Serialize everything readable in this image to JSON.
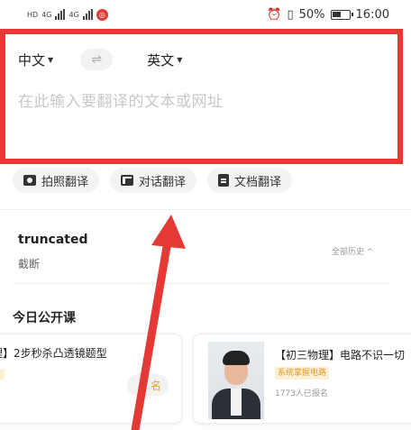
{
  "status_bar": {
    "sim_left": "HD",
    "net1": "4G",
    "net2": "4G",
    "battery": "50%",
    "time": "16:00"
  },
  "translator": {
    "source_lang": "中文",
    "target_lang": "英文",
    "placeholder": "在此输入要翻译的文本或网址"
  },
  "modes": [
    {
      "label": "拍照翻译",
      "icon": "camera-icon"
    },
    {
      "label": "对话翻译",
      "icon": "chat-icon"
    },
    {
      "label": "文档翻译",
      "icon": "document-icon"
    }
  ],
  "history": {
    "word": "truncated",
    "translation": "截断",
    "all_label": "全部历史 ^"
  },
  "courses": {
    "section_title": "今日公开课",
    "items": [
      {
        "title": "理】2步秒杀凸透镜题型",
        "button": "名"
      },
      {
        "title": "【初三物理】电路不识一切",
        "tag": "系统掌握电路",
        "enrolled": "1773人已报名"
      }
    ]
  },
  "colors": {
    "annotation_red": "#e53935",
    "tag_bg": "#fdf0d5",
    "tag_text": "#e39a2d"
  }
}
